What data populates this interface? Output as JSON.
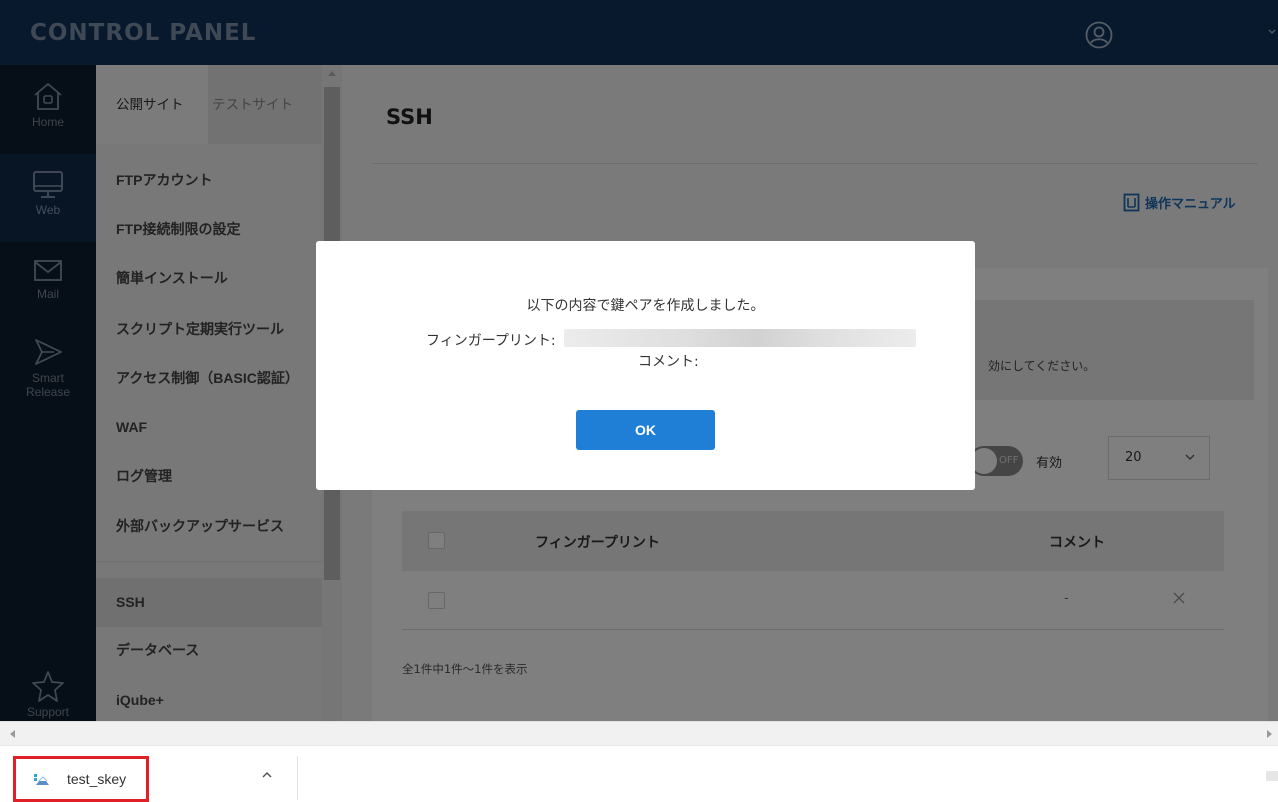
{
  "header": {
    "title": "CONTROL PANEL",
    "user_icon": "user-circle-icon"
  },
  "rail": {
    "items": [
      {
        "label": "Home",
        "icon": "home-icon"
      },
      {
        "label": "Web",
        "icon": "monitor-icon"
      },
      {
        "label": "Mail",
        "icon": "mail-icon"
      },
      {
        "label": "Smart",
        "label2": "Release",
        "icon": "send-icon"
      },
      {
        "label": "Support",
        "icon": "star-icon"
      }
    ]
  },
  "subnav": {
    "tabs": [
      "公開サイト",
      "テストサイト"
    ],
    "items": [
      "FTPアカウント",
      "FTP接続制限の設定",
      "簡単インストール",
      "スクリプト定期実行ツール",
      "アクセス制御（BASIC認証）",
      "WAF",
      "ログ管理",
      "外部バックアップサービス",
      "SSH",
      "データベース",
      "iQube+"
    ],
    "active": "SSH"
  },
  "main": {
    "title": "SSH",
    "manual_link": "操作マニュアル",
    "notice_text": "効にしてください。",
    "toggle_left": "効",
    "toggle_state": "OFF",
    "toggle_right": "有効",
    "per_page": "20",
    "table": {
      "headers": [
        "フィンガープリント",
        "コメント"
      ],
      "rows": [
        {
          "fingerprint": "",
          "comment": "-"
        }
      ]
    },
    "count_text": "全1件中1件～1件を表示"
  },
  "modal": {
    "message": "以下の内容で鍵ペアを作成しました。",
    "fingerprint_label": "フィンガープリント:",
    "comment_label": "コメント:",
    "ok_label": "OK"
  },
  "downloads": {
    "file_name": "test_skey"
  },
  "colors": {
    "header_bg": "#10305a",
    "rail_bg": "#0c1c2e",
    "accent": "#1f7fd6",
    "highlight_border": "#e01f27"
  }
}
